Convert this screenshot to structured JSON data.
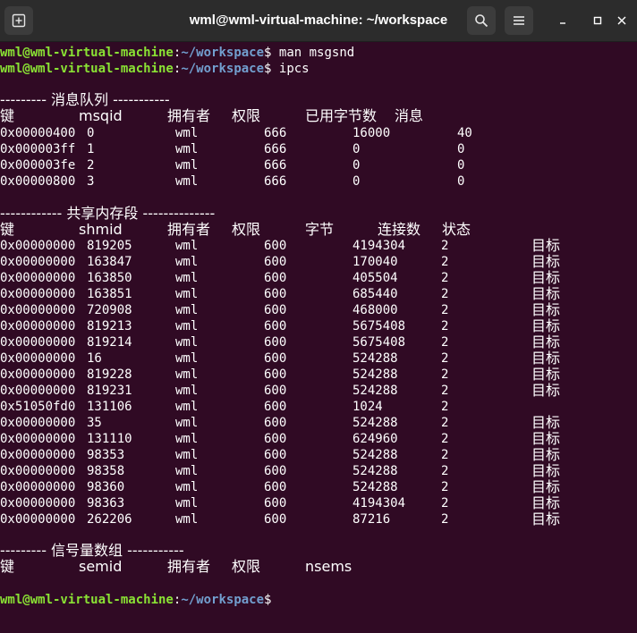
{
  "window": {
    "title": "wml@wml-virtual-machine: ~/workspace"
  },
  "prompt": {
    "user_host": "wml@wml-virtual-machine",
    "colon": ":",
    "path": "~/workspace",
    "dollar": "$"
  },
  "commands": [
    " man msgsnd",
    " ipcs"
  ],
  "queues": {
    "header": "--------- 消息队列 -----------",
    "cols": [
      "键",
      "msqid",
      "拥有者",
      "权限",
      "已用字节数",
      "消息"
    ],
    "rows": [
      [
        "0x00000400",
        "0",
        "wml",
        "666",
        "16000",
        "40"
      ],
      [
        "0x000003ff",
        "1",
        "wml",
        "666",
        "0",
        "0"
      ],
      [
        "0x000003fe",
        "2",
        "wml",
        "666",
        "0",
        "0"
      ],
      [
        "0x00000800",
        "3",
        "wml",
        "666",
        "0",
        "0"
      ]
    ]
  },
  "shm": {
    "header": "------------ 共享内存段 --------------",
    "cols": [
      "键",
      "shmid",
      "拥有者",
      "权限",
      "字节",
      "连接数",
      "状态"
    ],
    "rows": [
      [
        "0x00000000",
        "819205",
        "wml",
        "600",
        "4194304",
        "2",
        "目标"
      ],
      [
        "0x00000000",
        "163847",
        "wml",
        "600",
        "170040",
        "2",
        "目标"
      ],
      [
        "0x00000000",
        "163850",
        "wml",
        "600",
        "405504",
        "2",
        "目标"
      ],
      [
        "0x00000000",
        "163851",
        "wml",
        "600",
        "685440",
        "2",
        "目标"
      ],
      [
        "0x00000000",
        "720908",
        "wml",
        "600",
        "468000",
        "2",
        "目标"
      ],
      [
        "0x00000000",
        "819213",
        "wml",
        "600",
        "5675408",
        "2",
        "目标"
      ],
      [
        "0x00000000",
        "819214",
        "wml",
        "600",
        "5675408",
        "2",
        "目标"
      ],
      [
        "0x00000000",
        "16",
        "wml",
        "600",
        "524288",
        "2",
        "目标"
      ],
      [
        "0x00000000",
        "819228",
        "wml",
        "600",
        "524288",
        "2",
        "目标"
      ],
      [
        "0x00000000",
        "819231",
        "wml",
        "600",
        "524288",
        "2",
        "目标"
      ],
      [
        "0x51050fd0",
        "131106",
        "wml",
        "600",
        "1024",
        "2",
        ""
      ],
      [
        "0x00000000",
        "35",
        "wml",
        "600",
        "524288",
        "2",
        "目标"
      ],
      [
        "0x00000000",
        "131110",
        "wml",
        "600",
        "624960",
        "2",
        "目标"
      ],
      [
        "0x00000000",
        "98353",
        "wml",
        "600",
        "524288",
        "2",
        "目标"
      ],
      [
        "0x00000000",
        "98358",
        "wml",
        "600",
        "524288",
        "2",
        "目标"
      ],
      [
        "0x00000000",
        "98360",
        "wml",
        "600",
        "524288",
        "2",
        "目标"
      ],
      [
        "0x00000000",
        "98363",
        "wml",
        "600",
        "4194304",
        "2",
        "目标"
      ],
      [
        "0x00000000",
        "262206",
        "wml",
        "600",
        "87216",
        "2",
        "目标"
      ]
    ]
  },
  "sem": {
    "header": "--------- 信号量数组 -----------",
    "cols": [
      "键",
      "semid",
      "拥有者",
      "权限",
      "nsems"
    ]
  },
  "colors": {
    "background": "#300a24",
    "prompt_user": "#8ae234",
    "prompt_path": "#729fcf",
    "titlebar": "#2c2c2c"
  },
  "icons": {
    "new_tab": "new-tab-icon",
    "search": "search-icon",
    "menu": "hamburger-menu-icon",
    "minimize": "minimize-icon",
    "maximize": "maximize-icon",
    "close": "close-icon"
  }
}
